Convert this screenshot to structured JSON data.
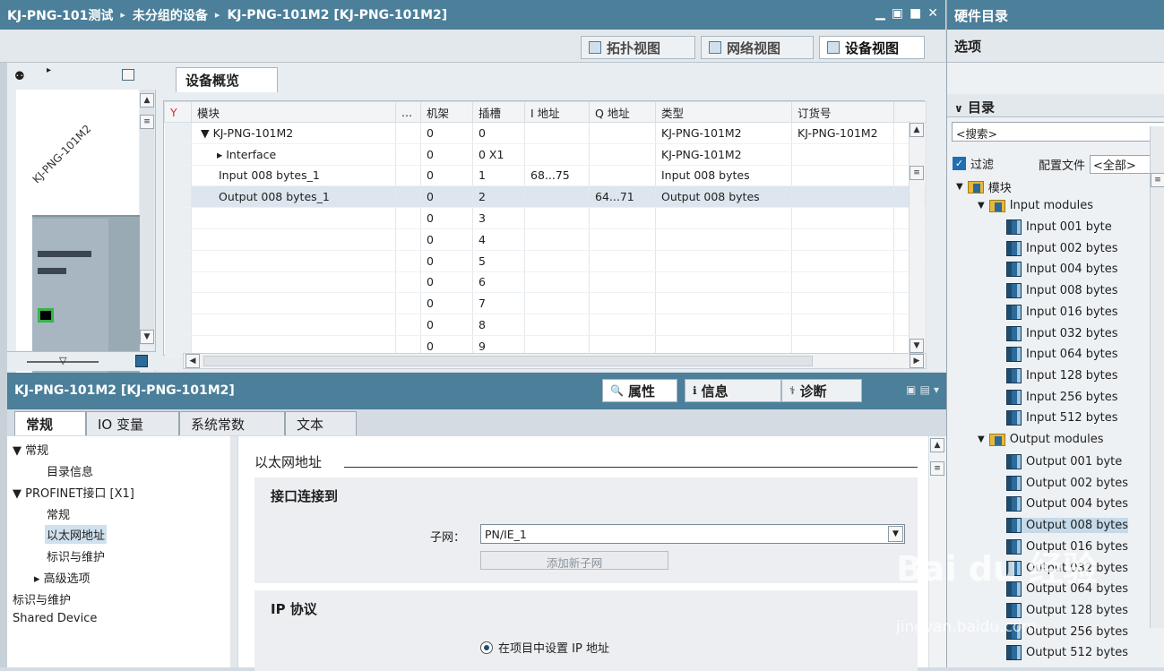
{
  "titlebar": {
    "crumbs": [
      "KJ-PNG-101测试",
      "未分组的设备",
      "KJ-PNG-101M2 [KJ-PNG-101M2]"
    ],
    "sep": "▸"
  },
  "views": {
    "topology": "拓扑视图",
    "network": "网络视图",
    "device": "设备视图"
  },
  "overview": {
    "tab": "设备概览",
    "columns": [
      "模块",
      "...",
      "机架",
      "插槽",
      "I 地址",
      "Q 地址",
      "类型",
      "订货号"
    ],
    "rows": [
      {
        "module": "▼ KJ-PNG-101M2",
        "rack": "0",
        "slot": "0",
        "i": "",
        "q": "",
        "type": "KJ-PNG-101M2",
        "order": "KJ-PNG-101M2"
      },
      {
        "module": "▸ Interface",
        "rack": "0",
        "slot": "0 X1",
        "i": "",
        "q": "",
        "type": "KJ-PNG-101M2",
        "order": ""
      },
      {
        "module": "Input 008 bytes_1",
        "rack": "0",
        "slot": "1",
        "i": "68...75",
        "q": "",
        "type": "Input 008 bytes",
        "order": ""
      },
      {
        "module": "Output 008 bytes_1",
        "rack": "0",
        "slot": "2",
        "i": "",
        "q": "64...71",
        "type": "Output 008 bytes",
        "order": ""
      },
      {
        "module": "",
        "rack": "0",
        "slot": "3",
        "i": "",
        "q": "",
        "type": "",
        "order": ""
      },
      {
        "module": "",
        "rack": "0",
        "slot": "4",
        "i": "",
        "q": "",
        "type": "",
        "order": ""
      },
      {
        "module": "",
        "rack": "0",
        "slot": "5",
        "i": "",
        "q": "",
        "type": "",
        "order": ""
      },
      {
        "module": "",
        "rack": "0",
        "slot": "6",
        "i": "",
        "q": "",
        "type": "",
        "order": ""
      },
      {
        "module": "",
        "rack": "0",
        "slot": "7",
        "i": "",
        "q": "",
        "type": "",
        "order": ""
      },
      {
        "module": "",
        "rack": "0",
        "slot": "8",
        "i": "",
        "q": "",
        "type": "",
        "order": ""
      },
      {
        "module": "",
        "rack": "0",
        "slot": "9",
        "i": "",
        "q": "",
        "type": "",
        "order": ""
      }
    ]
  },
  "device_label": "KJ-PNG-101M2",
  "properties": {
    "title": "KJ-PNG-101M2 [KJ-PNG-101M2]",
    "tabs": {
      "props": "属性",
      "info": "信息",
      "diag": "诊断"
    },
    "subtabs": [
      "常规",
      "IO 变量",
      "系统常数",
      "文本"
    ],
    "nav": [
      "▼ 常规",
      "目录信息",
      "▼ PROFINET接口 [X1]",
      "常规",
      "以太网地址",
      "标识与维护",
      "▸ 高级选项",
      "标识与维护",
      "Shared Device"
    ],
    "ethernet_title": "以太网地址",
    "connect_title": "接口连接到",
    "subnet_label": "子网：",
    "subnet_value": "PN/IE_1",
    "add_subnet": "添加新子网",
    "ip_title": "IP 协议",
    "ip_option": "在项目中设置 IP 地址"
  },
  "catalog": {
    "title": "硬件目录",
    "options": "选项",
    "section": "目录",
    "search": "<搜索>",
    "filter": "过滤",
    "profile_label": "配置文件",
    "profile_value": "<全部>",
    "root": "模块",
    "input_group": "Input modules",
    "inputs": [
      "Input 001 byte",
      "Input 002 bytes",
      "Input 004 bytes",
      "Input 008 bytes",
      "Input 016 bytes",
      "Input 032 bytes",
      "Input 064 bytes",
      "Input 128 bytes",
      "Input 256 bytes",
      "Input 512 bytes"
    ],
    "output_group": "Output modules",
    "outputs": [
      "Output 001 byte",
      "Output 002 bytes",
      "Output 004 bytes",
      "Output 008 bytes",
      "Output 016 bytes",
      "Output 032 bytes",
      "Output 064 bytes",
      "Output 128 bytes",
      "Output 256 bytes",
      "Output 512 bytes"
    ]
  },
  "watermark": {
    "logo": "Bai du 经验",
    "url": "jingyan.baidu.com"
  }
}
